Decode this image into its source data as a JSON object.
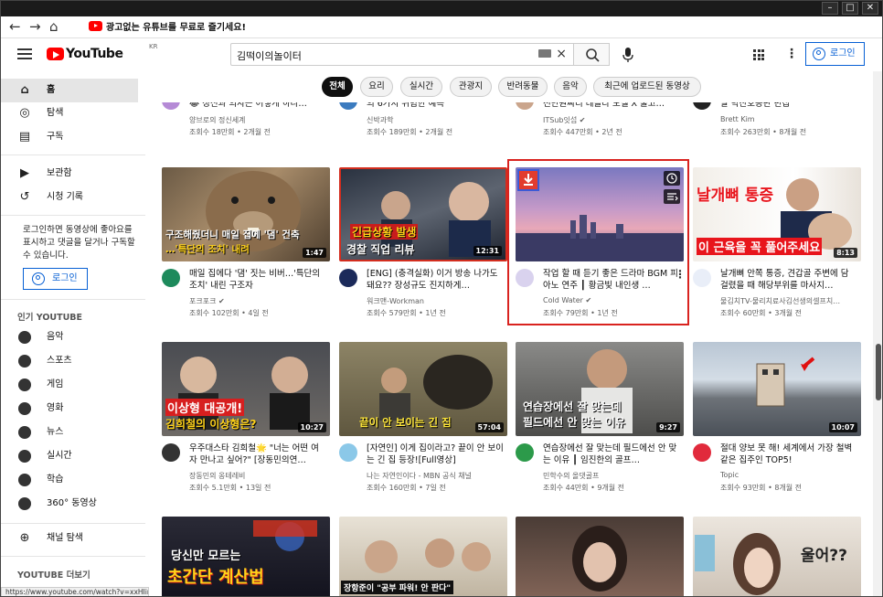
{
  "browser": {
    "tab_text": "광고없는 유튜브를 무료로 즐기세요!"
  },
  "masthead": {
    "logo_text": "YouTube",
    "region": "KR",
    "search_value": "김떡이의놀이터",
    "login_label": "로그인"
  },
  "sidebar": {
    "items": [
      {
        "label": "홈",
        "icon": "home-icon"
      },
      {
        "label": "탐색",
        "icon": "compass-icon"
      },
      {
        "label": "구독",
        "icon": "subscriptions-icon"
      },
      {
        "label": "보관함",
        "icon": "library-icon"
      },
      {
        "label": "시청 기록",
        "icon": "history-icon"
      }
    ],
    "login_message": "로그인하면 동영상에 좋아요를 표시하고 댓글을 달거나 구독할 수 있습니다.",
    "login_label": "로그인",
    "popular_heading": "인기 YOUTUBE",
    "popular": [
      {
        "label": "음악"
      },
      {
        "label": "스포츠"
      },
      {
        "label": "게임"
      },
      {
        "label": "영화"
      },
      {
        "label": "뉴스"
      },
      {
        "label": "실시간"
      },
      {
        "label": "학습"
      },
      {
        "label": "360° 동영상"
      }
    ],
    "browse_channels": "채널 탐색",
    "more_heading": "YOUTUBE 더보기"
  },
  "chips": [
    "전체",
    "요리",
    "실시간",
    "관광지",
    "반려동물",
    "음악",
    "최근에 업로드된 동영상"
  ],
  "row0": [
    {
      "title": "😂 정신과 의사는 어떻게 하나…",
      "channel": "양브로의 정신세계",
      "meta": "조회수 18만회 • 2개월 전"
    },
    {
      "title": "의 6가지 위험한 예측",
      "channel": "신박과학",
      "meta": "조회수 189만회 • 2개월 전"
    },
    {
      "title": "천만원짜리 테슬라 모델 X 줄고…",
      "channel": "ITSub잇섭 ✔",
      "meta": "조회수 447만회 • 2년 전"
    },
    {
      "title": "말 박찬호등판 편집",
      "channel": "Brett Kim",
      "meta": "조회수 263만회 • 8개월 전"
    }
  ],
  "row1": [
    {
      "title": "매일 집에다 '댐' 짓는 비버…'특단의 조치' 내린 구조자",
      "channel": "포크포크 ✔",
      "meta": "조회수 102만회 • 4일 전",
      "duration": "1:47",
      "overlay1": "구조해줬더니 매일 집에 '댐' 건축",
      "overlay2": "…'특단의 조치' 내려"
    },
    {
      "title": "[ENG] (충격실화) 이거 방송 나가도 돼요?? 장성규도 진지하게…",
      "channel": "워크맨-Workman",
      "meta": "조회수 579만회 • 1년 전",
      "duration": "12:31",
      "overlay1": "긴급상황 발생",
      "overlay2": "경찰 직업 리뷰"
    },
    {
      "title": "작업 할 때 듣기 좋은 드라마 BGM 피아노 연주 ┃ 황금빛 내인생 …",
      "channel": "Cold Water ✔",
      "meta": "조회수 79만회 • 1년 전",
      "duration": ""
    },
    {
      "title": "날개뼈 안쪽 통증, 견갑골 주변에 담 걸렸을 때 해당부위를 마사지…",
      "channel": "물김치TV-물리치료사김선생의셀프치…",
      "meta": "조회수 60만회 • 3개월 전",
      "duration": "8:13",
      "overlay1": "날개뼈 통증",
      "overlay2": "이 근육을 꼭 풀어주세요"
    }
  ],
  "row2": [
    {
      "title": "우주대스타 김희철🌟 \"너는 어떤 여자 만나고 싶어?\" [장동민의연…",
      "channel": "장동민의 옹테레비",
      "meta": "조회수 5.1만회 • 13일 전",
      "duration": "10:27",
      "overlay1": "이상형 대공개!",
      "overlay2": "김희철의 이상형은?"
    },
    {
      "title": "[자연인] 이게 집이라고? 끝이 안 보이는 긴 집 등장![Full영상]",
      "channel": "나는 자연인이다 - MBN 공식 채널",
      "meta": "조회수 160만회 • 7일 전",
      "duration": "57:04",
      "overlay1": "끝이 안 보이는 긴 집"
    },
    {
      "title": "연습장에선 잘 맞는데 필드에선 안 맞는 이유 ┃ 임진한의 골프…",
      "channel": "민학수의 올댓골프",
      "meta": "조회수 44만회 • 9개월 전",
      "duration": "9:27",
      "overlay1": "연습장에선 잘 맞는데",
      "overlay2": "필드에선 안 맞는 이유"
    },
    {
      "title": "절대 양보 못 해! 세계에서 가장 철벽같은 집주인 TOP5!",
      "channel": "Topic",
      "meta": "조회수 93만회 • 8개월 전",
      "duration": "10:07"
    }
  ],
  "row3": [
    {
      "overlay1": "당신만 모르는",
      "overlay2": "초간단 계산법"
    },
    {
      "overlay1": "장항준이 \"공부 파워! 안 판다\""
    },
    {},
    {
      "overlay1": "울어??"
    }
  ],
  "statusbar": "https://www.youtube.com/watch?v=xxHIirwT0VY"
}
